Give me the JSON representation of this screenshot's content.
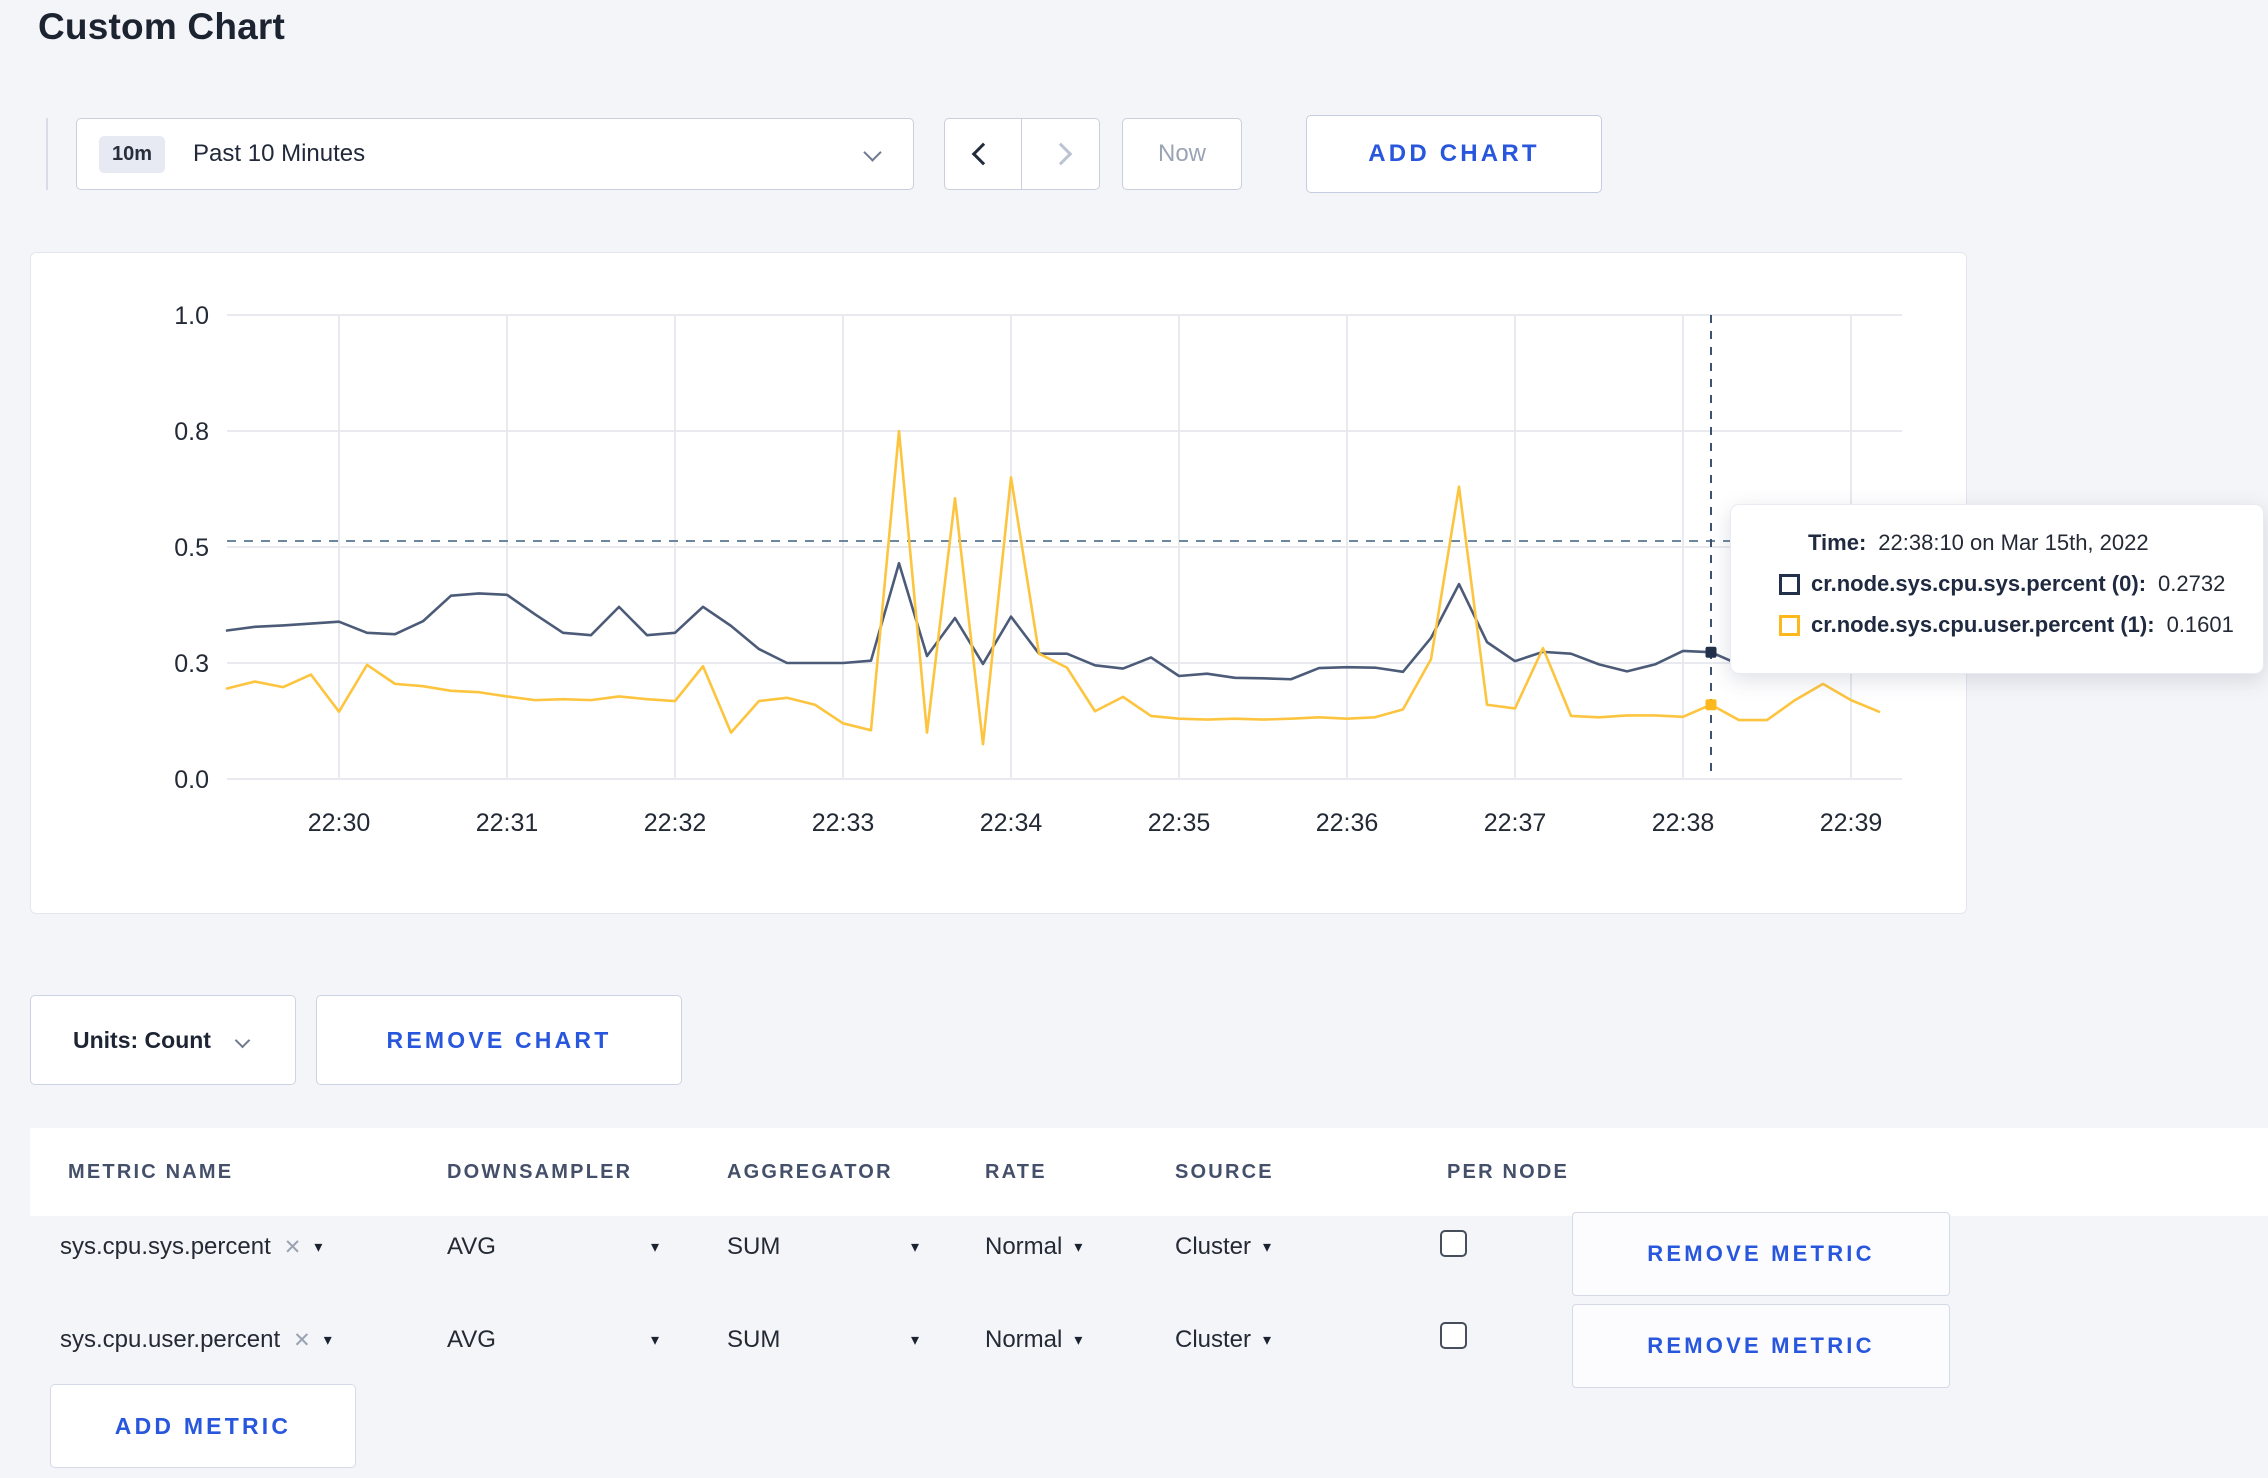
{
  "page": {
    "title": "Custom Chart"
  },
  "toolbar": {
    "range_badge": "10m",
    "range_label": "Past 10 Minutes",
    "now_label": "Now",
    "add_chart_label": "ADD CHART"
  },
  "chart_controls": {
    "units_label": "Units: Count",
    "remove_chart_label": "REMOVE CHART"
  },
  "chart_data": {
    "type": "line",
    "title": "",
    "xlabel": "",
    "ylabel": "",
    "ylim": [
      0,
      1
    ],
    "grid": true,
    "x_start": "22:29:20",
    "sample_interval_seconds": 10,
    "x_tick_labels": [
      "22:30",
      "22:31",
      "22:32",
      "22:33",
      "22:34",
      "22:35",
      "22:36",
      "22:37",
      "22:38",
      "22:39"
    ],
    "y_tick_labels": [
      "0.0",
      "0.3",
      "0.5",
      "0.8",
      "1.0"
    ],
    "y_tick_values": [
      0,
      0.25,
      0.5,
      0.75,
      1.0
    ],
    "guideline_value": 0.513,
    "crosshair_index": 53,
    "crosshair_time": "22:38:10",
    "series": [
      {
        "name": "cr.node.sys.cpu.sys.percent (0)",
        "color": "#4c5b78",
        "swatch": "#23304b",
        "values": [
          0.32,
          0.328,
          0.331,
          0.335,
          0.339,
          0.315,
          0.312,
          0.34,
          0.395,
          0.4,
          0.397,
          0.355,
          0.315,
          0.31,
          0.371,
          0.31,
          0.315,
          0.371,
          0.33,
          0.28,
          0.25,
          0.25,
          0.25,
          0.255,
          0.465,
          0.265,
          0.347,
          0.248,
          0.35,
          0.27,
          0.27,
          0.245,
          0.238,
          0.262,
          0.222,
          0.227,
          0.218,
          0.217,
          0.215,
          0.239,
          0.241,
          0.24,
          0.231,
          0.304,
          0.42,
          0.295,
          0.254,
          0.274,
          0.27,
          0.247,
          0.232,
          0.247,
          0.276,
          0.2732,
          0.247,
          0.25,
          0.26,
          0.25,
          0.255,
          0.25
        ]
      },
      {
        "name": "cr.node.sys.cpu.user.percent (1)",
        "color": "#fdc53f",
        "swatch": "#fdb81e",
        "values": [
          0.195,
          0.21,
          0.198,
          0.225,
          0.145,
          0.246,
          0.205,
          0.2,
          0.19,
          0.187,
          0.178,
          0.17,
          0.172,
          0.17,
          0.178,
          0.172,
          0.168,
          0.243,
          0.1,
          0.168,
          0.175,
          0.16,
          0.12,
          0.105,
          0.75,
          0.1,
          0.605,
          0.075,
          0.65,
          0.27,
          0.24,
          0.146,
          0.177,
          0.136,
          0.13,
          0.128,
          0.13,
          0.128,
          0.13,
          0.133,
          0.13,
          0.133,
          0.15,
          0.258,
          0.63,
          0.16,
          0.152,
          0.282,
          0.136,
          0.133,
          0.137,
          0.137,
          0.134,
          0.1601,
          0.127,
          0.127,
          0.17,
          0.205,
          0.17,
          0.145
        ]
      }
    ],
    "tooltip": {
      "time_label": "Time:",
      "time_value": "22:38:10 on Mar 15th, 2022",
      "rows": [
        {
          "label": "cr.node.sys.cpu.sys.percent (0):",
          "value": "0.2732"
        },
        {
          "label": "cr.node.sys.cpu.user.percent (1):",
          "value": "0.1601"
        }
      ]
    }
  },
  "metrics_table": {
    "headers": [
      "METRIC NAME",
      "DOWNSAMPLER",
      "AGGREGATOR",
      "RATE",
      "SOURCE",
      "PER NODE"
    ],
    "rows": [
      {
        "metric": "sys.cpu.sys.percent",
        "downsampler": "AVG",
        "aggregator": "SUM",
        "rate": "Normal",
        "source": "Cluster",
        "per_node_checked": false,
        "remove_label": "REMOVE METRIC"
      },
      {
        "metric": "sys.cpu.user.percent",
        "downsampler": "AVG",
        "aggregator": "SUM",
        "rate": "Normal",
        "source": "Cluster",
        "per_node_checked": false,
        "remove_label": "REMOVE METRIC"
      }
    ],
    "add_metric_label": "ADD METRIC"
  }
}
